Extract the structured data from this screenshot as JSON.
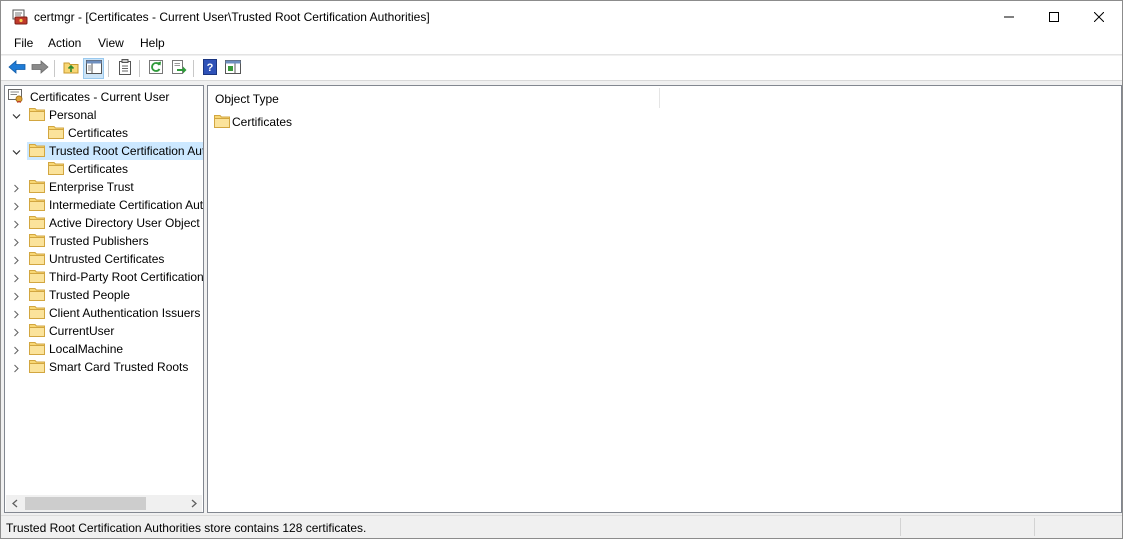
{
  "window": {
    "title": "certmgr - [Certificates - Current User\\Trusted Root Certification Authorities]",
    "app_icon": "certificate-manager-icon"
  },
  "menu": [
    "File",
    "Action",
    "View",
    "Help"
  ],
  "toolbar": {
    "buttons": [
      "back-arrow-icon",
      "forward-arrow-icon",
      "up-folder-icon",
      "show-hide-tree-icon",
      "properties-icon",
      "refresh-icon",
      "export-list-icon",
      "help-icon",
      "show-hide-action-pane-icon"
    ],
    "pressed": "show-hide-tree-icon"
  },
  "tree": {
    "root": "Certificates - Current User",
    "items": [
      {
        "label": "Personal",
        "expanded": true,
        "level": 1
      },
      {
        "label": "Certificates",
        "level": 2
      },
      {
        "label": "Trusted Root Certification Authorities",
        "expanded": true,
        "selected": true,
        "level": 1
      },
      {
        "label": "Certificates",
        "level": 2
      },
      {
        "label": "Enterprise Trust",
        "level": 1
      },
      {
        "label": "Intermediate Certification Authorities",
        "level": 1
      },
      {
        "label": "Active Directory User Object",
        "level": 1
      },
      {
        "label": "Trusted Publishers",
        "level": 1
      },
      {
        "label": "Untrusted Certificates",
        "level": 1
      },
      {
        "label": "Third-Party Root Certification Authorities",
        "level": 1
      },
      {
        "label": "Trusted People",
        "level": 1
      },
      {
        "label": "Client Authentication Issuers",
        "level": 1
      },
      {
        "label": "CurrentUser",
        "level": 1
      },
      {
        "label": "LocalMachine",
        "level": 1
      },
      {
        "label": "Smart Card Trusted Roots",
        "level": 1
      }
    ]
  },
  "list": {
    "column_header": "Object Type",
    "items": [
      "Certificates"
    ]
  },
  "status": {
    "text": "Trusted Root Certification Authorities store contains 128 certificates."
  },
  "colors": {
    "selection": "#cce8ff",
    "folder": "#f8d775",
    "folder_dark": "#e2b849",
    "back_arrow": "#1e7bd6"
  }
}
